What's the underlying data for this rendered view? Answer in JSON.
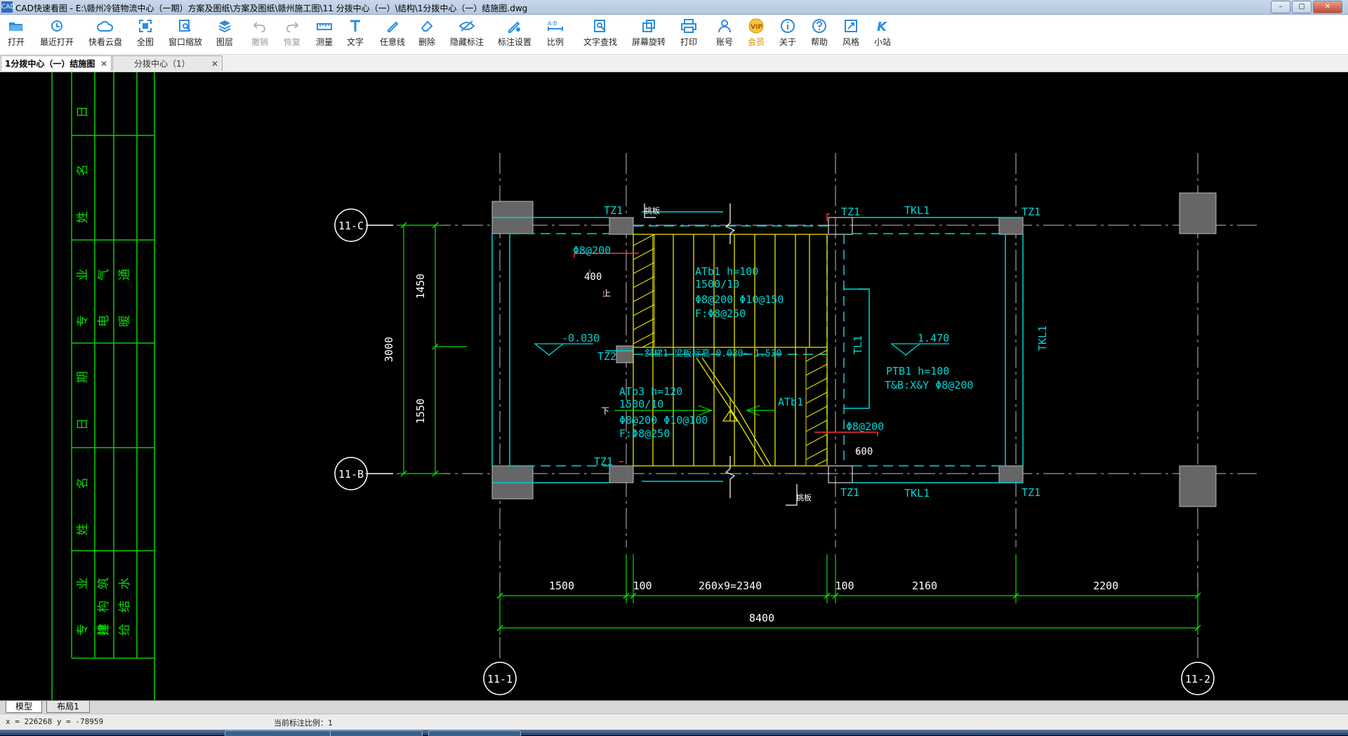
{
  "window": {
    "title": "CAD快速看图 - E:\\赣州冷链物流中心（一期）方案及图纸\\方案及图纸\\赣州施工图\\11 分拨中心（一）\\结构\\1分拨中心（一）结施图.dwg",
    "app_icon": "CAD",
    "controls": [
      "–",
      "▢",
      "✕"
    ]
  },
  "toolbar": [
    {
      "label": "打开",
      "icon": "folder-open-icon",
      "enabled": true
    },
    {
      "label": "最近打开",
      "icon": "history-icon",
      "enabled": true
    },
    {
      "label": "快看云盘",
      "icon": "cloud-icon",
      "enabled": true
    },
    {
      "label": "全图",
      "icon": "fit-all-icon",
      "enabled": true
    },
    {
      "label": "窗口缩放",
      "icon": "zoom-window-icon",
      "enabled": true
    },
    {
      "label": "图层",
      "icon": "layers-icon",
      "enabled": true
    },
    {
      "label": "撤销",
      "icon": "undo-icon",
      "enabled": false
    },
    {
      "label": "恢复",
      "icon": "redo-icon",
      "enabled": false
    },
    {
      "label": "测量",
      "icon": "measure-icon",
      "enabled": true
    },
    {
      "label": "文字",
      "icon": "text-icon",
      "enabled": true
    },
    {
      "label": "任意线",
      "icon": "pen-icon",
      "enabled": true
    },
    {
      "label": "删除",
      "icon": "eraser-icon",
      "enabled": true
    },
    {
      "label": "隐藏标注",
      "icon": "hide-eye-icon",
      "enabled": true
    },
    {
      "label": "标注设置",
      "icon": "annotation-settings-icon",
      "enabled": true
    },
    {
      "label": "比例",
      "icon": "scale-icon",
      "enabled": true
    },
    {
      "label": "文字查找",
      "icon": "text-search-icon",
      "enabled": true
    },
    {
      "label": "屏幕旋转",
      "icon": "rotate-screen-icon",
      "enabled": true
    },
    {
      "label": "打印",
      "icon": "printer-icon",
      "enabled": true
    },
    {
      "label": "账号",
      "icon": "user-icon",
      "enabled": true
    },
    {
      "label": "会员",
      "icon": "vip-icon",
      "enabled": true
    },
    {
      "label": "关于",
      "icon": "info-icon",
      "enabled": true
    },
    {
      "label": "帮助",
      "icon": "help-icon",
      "enabled": true
    },
    {
      "label": "风格",
      "icon": "style-icon",
      "enabled": true
    },
    {
      "label": "小站",
      "icon": "k-station-icon",
      "enabled": true
    }
  ],
  "tabs": [
    {
      "label": "1分拨中心（一）结施图",
      "active": true,
      "close": "✕"
    },
    {
      "label": "分拨中心（1）",
      "active": false,
      "close": "✕"
    }
  ],
  "drawing": {
    "colors": {
      "grid": "#bfbfbf",
      "structure": "#00d4d4",
      "stair": "#e6e600",
      "dim": "#00e000",
      "red": "#ff3030",
      "white": "#ffffff"
    },
    "axes": {
      "top": "11-C",
      "bottom": "11-B",
      "left": "11-1",
      "right": "11-2"
    },
    "title_block": {
      "col1": [
        "日",
        "名",
        "姓",
        "业",
        "专",
        "期",
        "日",
        "名",
        "姓",
        "业",
        "专"
      ],
      "col2": [
        "气",
        "电",
        "筑",
        "构",
        "排"
      ],
      "col3": [
        "通",
        "暖",
        "建",
        "结",
        "给",
        "水"
      ]
    },
    "labels": {
      "tz1_a": "TZ1",
      "tz1_b": "TZ1",
      "tz1_c": "TZ1",
      "tz1_d": "TZ1",
      "tz1_e": "TZ1",
      "tz1_f": "TZ1",
      "tz2": "TZ2",
      "tkl1_top": "TKL1",
      "tkl1_bottom": "TKL1",
      "tkl1_right": "TKL1",
      "tl1": "TL1",
      "ban_top": "挑板",
      "ban_bottom": "挑板",
      "atb1_a": "ATb1 h=100",
      "atb1_b": "1500/10",
      "atb1_c": "Φ8@200 Φ10@150",
      "atb1_d": "F:Φ8@250",
      "atb3_a": "ATb3 h=120",
      "atb3_b": "1500/10",
      "atb3_c": "Φ8@200 Φ10@100",
      "atb3_d": "F:Φ8@250",
      "atb1_arrow": "ATb1",
      "phi_top": "Φ8@200",
      "n400": "400",
      "phi_right": "Φ8@200",
      "n600": "600",
      "elev_left": "-0.030",
      "elev_right": "1.470",
      "ptb_a": "PTB1 h=100",
      "ptb_b": "T&B:X&Y Φ8@200",
      "mid_note": "斜梯1 梁板标高-0.030~-1.530",
      "up": "上",
      "down": "下",
      "d1450": "1450",
      "d1550": "1550",
      "d3000": "3000",
      "d1500": "1500",
      "d100a": "100",
      "d2340": "260x9=2340",
      "d100b": "100",
      "d2160": "2160",
      "d2200": "2200",
      "d8400": "8400"
    }
  },
  "layout_tabs": [
    {
      "label": "模型",
      "active": true
    },
    {
      "label": "布局1",
      "active": false
    }
  ],
  "status": {
    "coords": "x = 226268  y = -78959",
    "scale_text": "当前标注比例：1"
  }
}
